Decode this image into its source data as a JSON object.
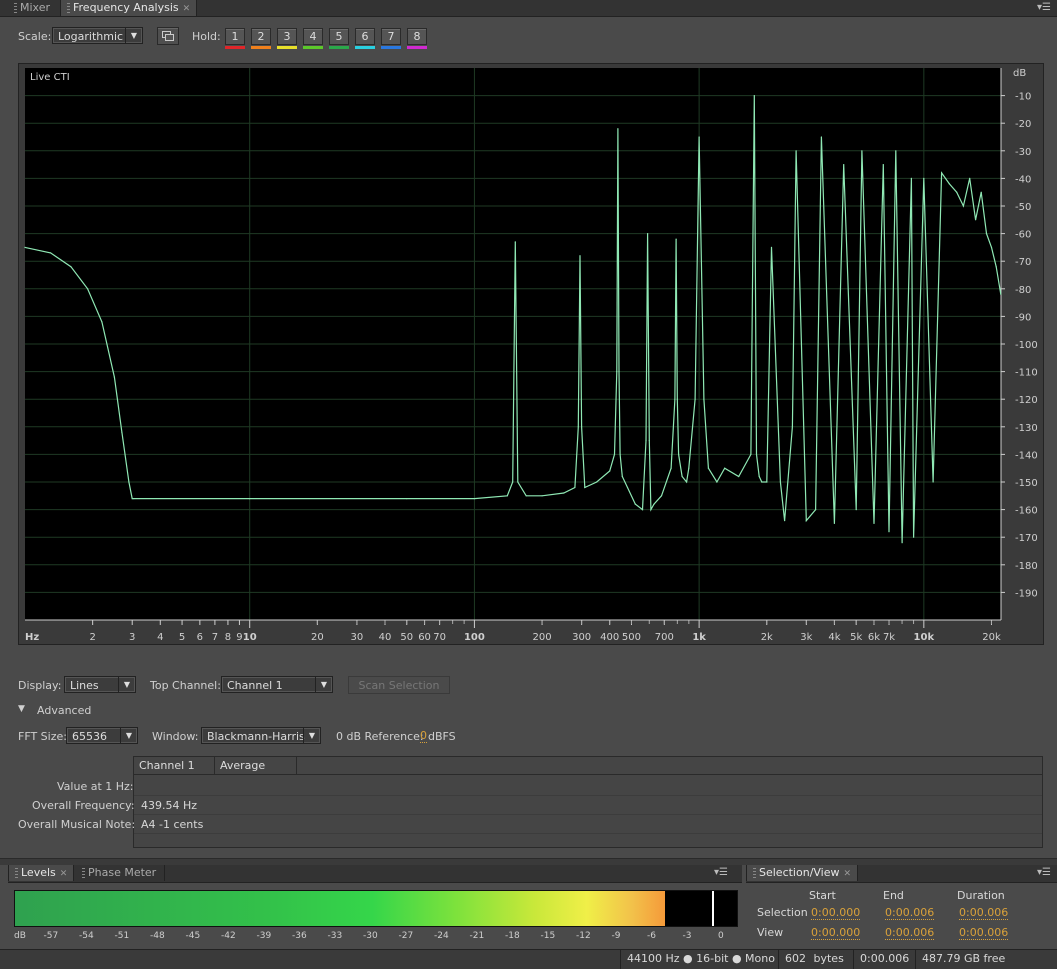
{
  "tabs": {
    "mixer": "Mixer",
    "frequency_analysis": "Frequency Analysis"
  },
  "toolbar": {
    "scale_label": "Scale:",
    "scale_value": "Logarithmic",
    "hold_label": "Hold:",
    "hold_buttons": [
      {
        "label": "1",
        "color": "#e0262a"
      },
      {
        "label": "2",
        "color": "#f0801c"
      },
      {
        "label": "3",
        "color": "#e8e02a"
      },
      {
        "label": "4",
        "color": "#5cc82a"
      },
      {
        "label": "5",
        "color": "#2aa84a"
      },
      {
        "label": "6",
        "color": "#2ad0e0"
      },
      {
        "label": "7",
        "color": "#2a78e0"
      },
      {
        "label": "8",
        "color": "#d02ad0"
      }
    ]
  },
  "graph": {
    "cti_label": "Live CTI",
    "y_unit": "dB",
    "y_ticks": [
      "-10",
      "-20",
      "-30",
      "-40",
      "-50",
      "-60",
      "-70",
      "-80",
      "-90",
      "-100",
      "-110",
      "-120",
      "-130",
      "-140",
      "-150",
      "-160",
      "-170",
      "-180",
      "-190"
    ],
    "x_unit": "Hz",
    "x_ticks": [
      "2",
      "3",
      "4",
      "5",
      "6",
      "7",
      "8",
      "9",
      "10",
      "20",
      "30",
      "40",
      "50",
      "60",
      "70",
      "100",
      "200",
      "300",
      "400",
      "500",
      "700",
      "1k",
      "2k",
      "3k",
      "4k",
      "5k",
      "6k",
      "7k",
      "10k",
      "20k"
    ],
    "line_color": "#8fe8b4"
  },
  "chart_data": {
    "type": "line",
    "title": "",
    "xlabel": "Hz",
    "ylabel": "dB",
    "x_scale": "log",
    "xlim": [
      1,
      22050
    ],
    "ylim": [
      -200,
      0
    ],
    "grid": true,
    "series": [
      {
        "x": [
          1,
          1.3,
          1.6,
          1.9,
          2.2,
          2.5,
          2.7,
          2.9,
          3,
          3.05,
          10,
          50,
          100,
          140,
          148,
          152,
          156,
          170,
          200,
          250,
          280,
          290,
          295,
          300,
          310,
          350,
          400,
          420,
          430,
          435,
          440,
          445,
          455,
          480,
          520,
          560,
          580,
          590,
          600,
          610,
          630,
          680,
          750,
          780,
          790,
          800,
          810,
          840,
          880,
          900,
          960,
          1000,
          1050,
          1100,
          1200,
          1300,
          1500,
          1700,
          1760,
          1800,
          1850,
          1900,
          2000,
          2100,
          2300,
          2400,
          2600,
          2700,
          3000,
          3300,
          3500,
          4000,
          4400,
          5000,
          5300,
          6000,
          6600,
          7000,
          7500,
          8000,
          8800,
          9000,
          10000,
          11000,
          12000,
          13000,
          14000,
          15000,
          16000,
          17000,
          18000,
          19000,
          20000,
          21000,
          22000
        ],
        "y": [
          -65,
          -67,
          -72,
          -80,
          -92,
          -112,
          -132,
          -150,
          -156,
          -156,
          -156,
          -156,
          -156,
          -155,
          -150,
          -63,
          -150,
          -155,
          -155,
          -154,
          -152,
          -130,
          -68,
          -130,
          -152,
          -150,
          -146,
          -140,
          -110,
          -22,
          -110,
          -140,
          -148,
          -152,
          -158,
          -160,
          -135,
          -60,
          -135,
          -160,
          -158,
          -155,
          -145,
          -120,
          -62,
          -120,
          -140,
          -148,
          -150,
          -145,
          -120,
          -25,
          -120,
          -145,
          -150,
          -145,
          -148,
          -140,
          -10,
          -140,
          -148,
          -150,
          -150,
          -65,
          -150,
          -164,
          -130,
          -30,
          -164,
          -160,
          -25,
          -165,
          -35,
          -160,
          -30,
          -165,
          -35,
          -168,
          -30,
          -172,
          -40,
          -170,
          -40,
          -150,
          -38,
          -42,
          -45,
          -50,
          -40,
          -55,
          -45,
          -60,
          -65,
          -72,
          -82
        ]
      }
    ]
  },
  "display": {
    "display_label": "Display:",
    "display_value": "Lines",
    "top_channel_label": "Top Channel:",
    "top_channel_value": "Channel 1",
    "scan_button": "Scan Selection"
  },
  "advanced": {
    "label": "Advanced",
    "fft_label": "FFT Size:",
    "fft_value": "65536",
    "window_label": "Window:",
    "window_value": "Blackmann-Harris",
    "ref_label": "0 dB Reference:",
    "ref_value": "0",
    "ref_unit": "dBFS"
  },
  "results": {
    "headers": [
      "Channel 1",
      "Average"
    ],
    "rows": [
      {
        "label": "Value at 1 Hz:",
        "value": ""
      },
      {
        "label": "Overall Frequency:",
        "value": "439.54 Hz"
      },
      {
        "label": "Overall Musical Note:",
        "value": "A4 -1 cents"
      }
    ]
  },
  "levels": {
    "tab_levels": "Levels",
    "tab_phase": "Phase Meter",
    "scale": [
      "dB",
      "-57",
      "-54",
      "-51",
      "-48",
      "-45",
      "-42",
      "-39",
      "-36",
      "-33",
      "-30",
      "-27",
      "-24",
      "-21",
      "-18",
      "-15",
      "-12",
      "-9",
      "-6",
      "-3",
      "0"
    ],
    "level_fraction": 0.9,
    "peak_fraction": 0.965
  },
  "selection_view": {
    "title": "Selection/View",
    "col_start": "Start",
    "col_end": "End",
    "col_duration": "Duration",
    "row_selection": "Selection",
    "row_view": "View",
    "selection": [
      "0:00.000",
      "0:00.006",
      "0:00.006"
    ],
    "view": [
      "0:00.000",
      "0:00.006",
      "0:00.006"
    ]
  },
  "status": {
    "format": "44100 Hz ● 16-bit ● Mono",
    "size": "602",
    "size_unit": "bytes",
    "duration": "0:00.006",
    "free": "487.79 GB free"
  }
}
